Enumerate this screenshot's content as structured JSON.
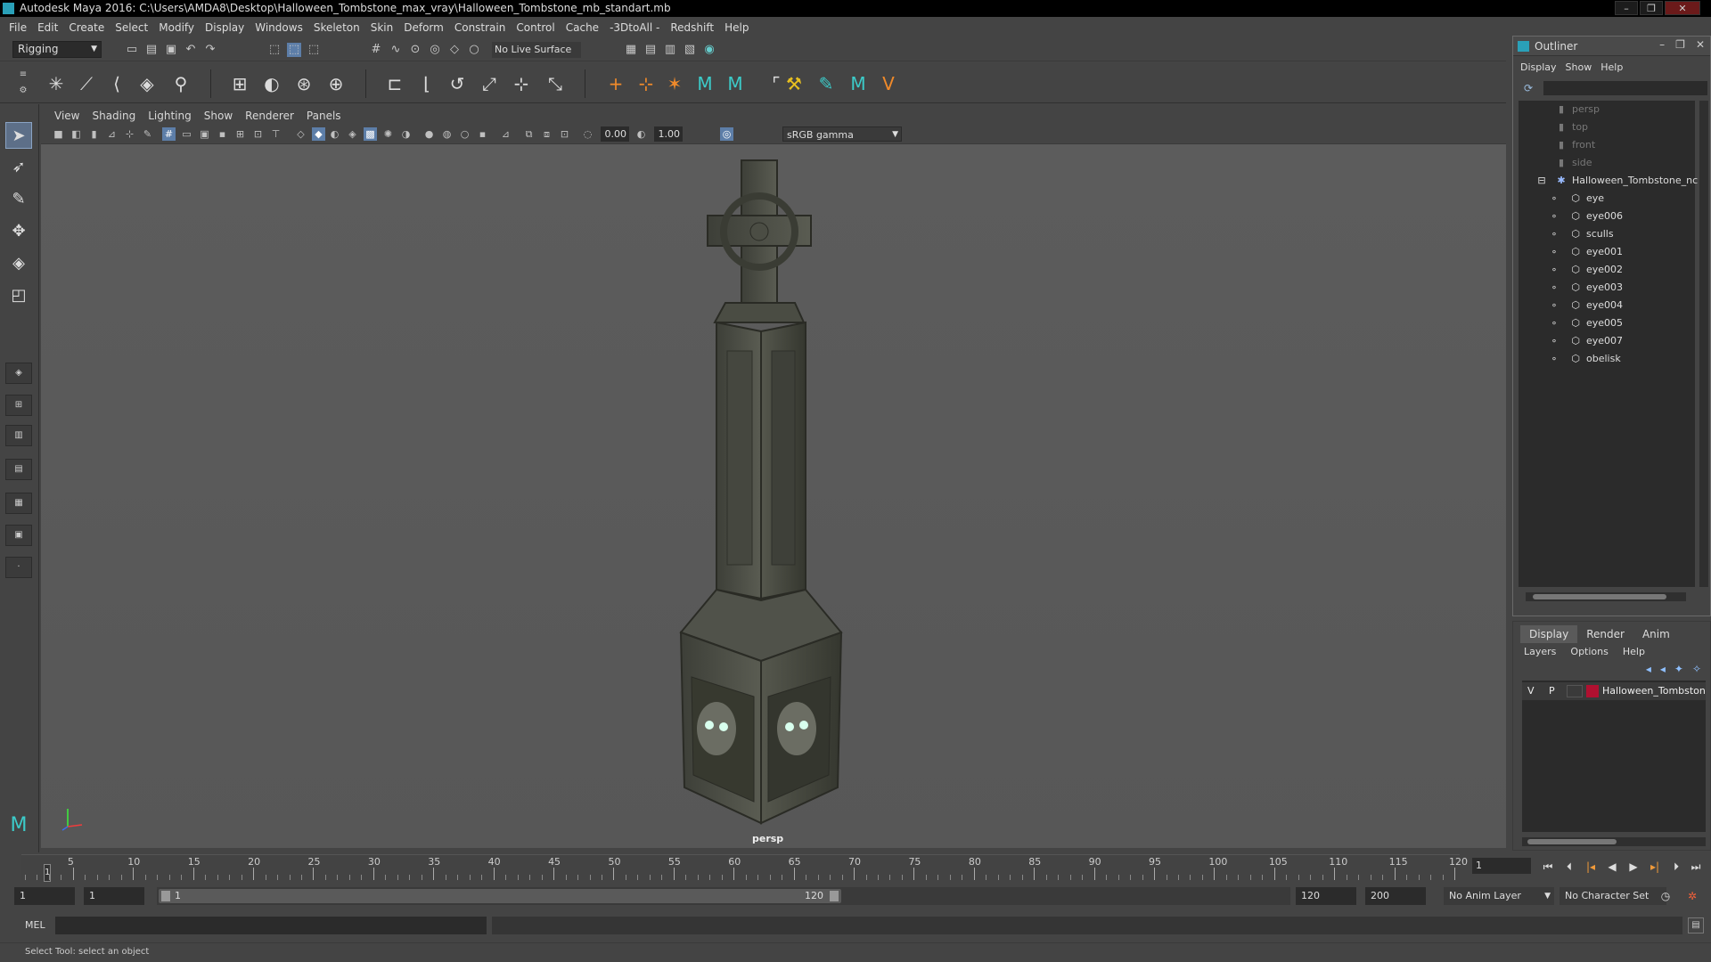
{
  "window": {
    "title": "Autodesk Maya 2016: C:\\Users\\AMDA8\\Desktop\\Halloween_Tombstone_max_vray\\Halloween_Tombstone_mb_standart.mb"
  },
  "menubar": {
    "items": [
      "File",
      "Edit",
      "Create",
      "Select",
      "Modify",
      "Display",
      "Windows",
      "Skeleton",
      "Skin",
      "Deform",
      "Constrain",
      "Control",
      "Cache",
      "-3DtoAll -",
      "Redshift",
      "Help"
    ]
  },
  "statusline": {
    "mode": "Rigging",
    "live_surface": "No Live Surface"
  },
  "viewport": {
    "menu": [
      "View",
      "Shading",
      "Lighting",
      "Show",
      "Renderer",
      "Panels"
    ],
    "exposure": "0.00",
    "gamma": "1.00",
    "color_space": "sRGB gamma",
    "camera_label": "persp"
  },
  "outliner": {
    "title": "Outliner",
    "menu": [
      "Display",
      "Show",
      "Help"
    ],
    "items": [
      {
        "label": "persp",
        "type": "camera"
      },
      {
        "label": "top",
        "type": "camera"
      },
      {
        "label": "front",
        "type": "camera"
      },
      {
        "label": "side",
        "type": "camera"
      },
      {
        "label": "Halloween_Tombstone_nc",
        "type": "group"
      },
      {
        "label": "eye",
        "type": "mesh"
      },
      {
        "label": "eye006",
        "type": "mesh"
      },
      {
        "label": "sculls",
        "type": "mesh"
      },
      {
        "label": "eye001",
        "type": "mesh"
      },
      {
        "label": "eye002",
        "type": "mesh"
      },
      {
        "label": "eye003",
        "type": "mesh"
      },
      {
        "label": "eye004",
        "type": "mesh"
      },
      {
        "label": "eye005",
        "type": "mesh"
      },
      {
        "label": "eye007",
        "type": "mesh"
      },
      {
        "label": "obelisk",
        "type": "mesh"
      }
    ]
  },
  "layers": {
    "tabs": [
      "Display",
      "Render",
      "Anim"
    ],
    "active_tab": "Display",
    "menu": [
      "Layers",
      "Options",
      "Help"
    ],
    "rows": [
      {
        "v": "V",
        "p": "P",
        "name": "Halloween_Tombstone",
        "color": "#b01030"
      }
    ]
  },
  "timeslider": {
    "ticks": [
      "5",
      "10",
      "15",
      "20",
      "25",
      "30",
      "35",
      "40",
      "45",
      "50",
      "55",
      "60",
      "65",
      "70",
      "75",
      "80",
      "85",
      "90",
      "95",
      "100",
      "105",
      "110",
      "115",
      "120"
    ],
    "current_frame": "1",
    "current_field": "1"
  },
  "rangeslider": {
    "start": "1",
    "playback_start": "1",
    "thumb_start": "1",
    "thumb_end": "120",
    "playback_end": "120",
    "end": "200",
    "anim_layer": "No Anim Layer",
    "character_set": "No Character Set"
  },
  "cmdline": {
    "label": "MEL"
  },
  "helpline": {
    "text": "Select Tool: select an object"
  }
}
